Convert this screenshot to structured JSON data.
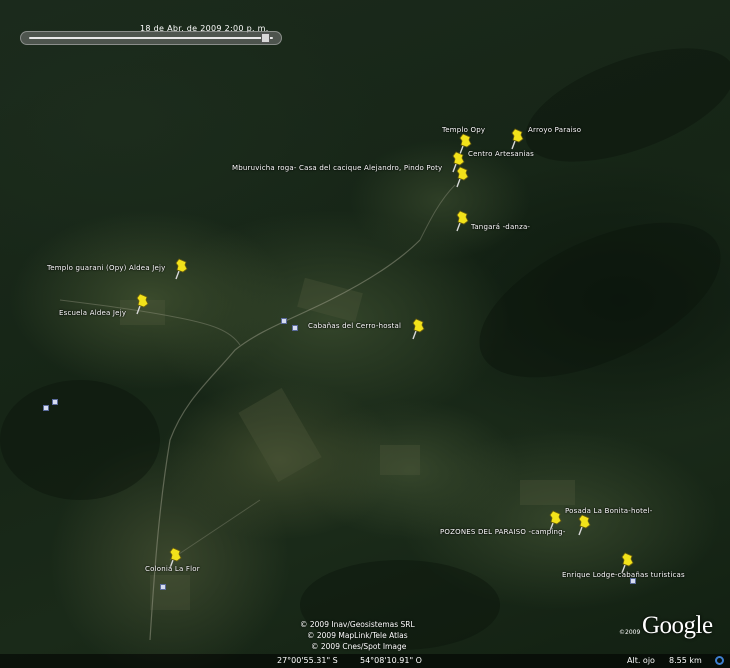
{
  "time_slider": {
    "date_label": "18 de Abr. de 2009   2:00 p. m."
  },
  "placemarks": [
    {
      "label": "Templo Opy"
    },
    {
      "label": "Arroyo Paraiso"
    },
    {
      "label": "Centro Artesanias"
    },
    {
      "label": "Mburuvicha roga- Casa del cacique Alejandro, Pindo Poty"
    },
    {
      "label": "Tangará -danza-"
    },
    {
      "label": "Templo guarani (Opy) Aldea Jejy"
    },
    {
      "label": "Escuela Aldea Jejy"
    },
    {
      "label": "Cabañas del Cerro-hostal"
    },
    {
      "label": "Posada La Bonita-hotel-"
    },
    {
      "label": "POZONES DEL PARAISO -camping-"
    },
    {
      "label": "Colonia La Flor"
    },
    {
      "label": "Enrique Lodge-cabañas turisticas"
    }
  ],
  "attribution": {
    "line1": "© 2009 Inav/Geosistemas SRL",
    "line2": "© 2009 MapLink/Tele Atlas",
    "line3": "© 2009 Cnes/Spot Image",
    "copyright_small": "©2009",
    "logo": "Google"
  },
  "status_bar": {
    "latitude": "27°00'55.31\" S",
    "longitude": "54°08'10.91\" O",
    "eye_alt_label": "Alt. ojo",
    "eye_alt_value": "8.55 km"
  },
  "colors": {
    "pin": "#f2e21a",
    "forest": "#1a2a19",
    "status_ring": "#3f7fd0"
  }
}
